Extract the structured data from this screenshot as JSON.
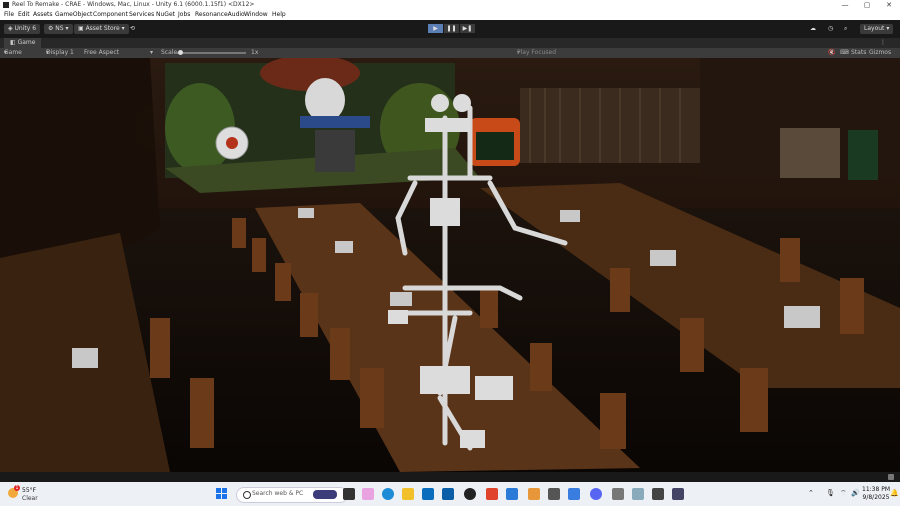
{
  "window": {
    "title": "Reel To Remake - CRAE - Windows, Mac, Linux - Unity 6.1 (6000.1.15f1) <DX12>",
    "controls": [
      "—",
      "▢",
      "✕"
    ]
  },
  "menu": [
    "File",
    "Edit",
    "Assets",
    "GameObject",
    "Component",
    "Services",
    "NuGet",
    "Jobs",
    "ResonanceAudio",
    "Window",
    "Help"
  ],
  "toolbar": {
    "unity_label": "Unity 6",
    "user_initials": "NS",
    "asset_store_label": "Asset Store",
    "layout_label": "Layout",
    "play_buttons": [
      "▶",
      "❚❚",
      "▶❚"
    ]
  },
  "game_tab": {
    "label": "Game",
    "mode": "Game",
    "display": "Display 1",
    "aspect": "Free Aspect",
    "scale_label": "Scale",
    "scale_value": "1x",
    "play_focused": "Play Focused",
    "stats": "Stats",
    "gizmos": "Gizmos"
  },
  "taskbar": {
    "weather_temp": "55°F",
    "weather_cond": "Clear",
    "weather_badge": "1",
    "search_placeholder": "Search web & PC",
    "time": "11:38 PM",
    "date": "9/8/2025"
  }
}
